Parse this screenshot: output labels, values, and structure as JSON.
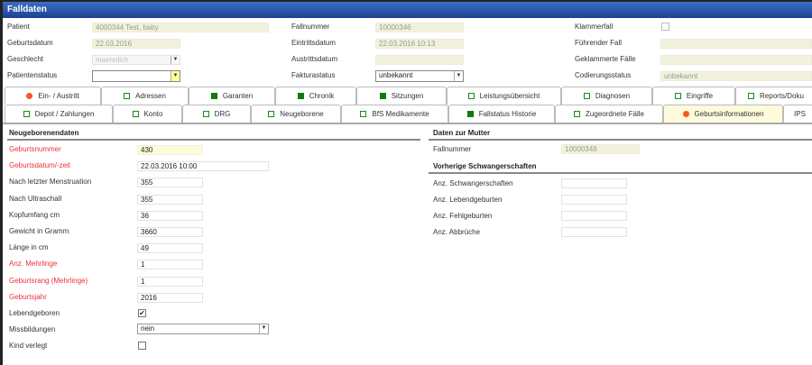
{
  "title": "Falldaten",
  "header": {
    "patient_label": "Patient",
    "patient_value": "4000344 Test,  baby",
    "geburtsdatum_label": "Geburtsdatum",
    "geburtsdatum_value": "22.03.2016",
    "geschlecht_label": "Geschlecht",
    "geschlecht_value": "maennlich",
    "patientenstatus_label": "Patientenstatus",
    "patientenstatus_value": "",
    "fallnummer_label": "Fallnummer",
    "fallnummer_value": "10000346",
    "eintrittsdatum_label": "Eintrittsdatum",
    "eintrittsdatum_value": "22.03.2016 10:13",
    "austrittsdatum_label": "Austrittsdatum",
    "austrittsdatum_value": "",
    "fakturastatus_label": "Fakturastatus",
    "fakturastatus_value": "unbekannt",
    "klammerfall_label": "Klammerfall",
    "fuehrender_fall_label": "Führender Fall",
    "geklammerte_faelle_label": "Geklammerte Fälle",
    "codierungsstatus_label": "Codierungsstatus",
    "codierungsstatus_value": "unbekannt"
  },
  "tabs_row1": [
    {
      "label": "Ein- / Austritt",
      "icon": "dot"
    },
    {
      "label": "Adressen",
      "icon": "open"
    },
    {
      "label": "Garanten",
      "icon": "fill"
    },
    {
      "label": "Chronik",
      "icon": "fill"
    },
    {
      "label": "Sitzungen",
      "icon": "fill"
    },
    {
      "label": "Leistungsübersicht",
      "icon": "open"
    },
    {
      "label": "Diagnosen",
      "icon": "open"
    },
    {
      "label": "Eingriffe",
      "icon": "open"
    },
    {
      "label": "Reports/Doku",
      "icon": "open"
    }
  ],
  "tabs_row2": [
    {
      "label": "Depot / Zahlungen",
      "icon": "open"
    },
    {
      "label": "Konto",
      "icon": "open"
    },
    {
      "label": "DRG",
      "icon": "open"
    },
    {
      "label": "Neugeborene",
      "icon": "open"
    },
    {
      "label": "BfS Medikamente",
      "icon": "open"
    },
    {
      "label": "Fallstatus Historie",
      "icon": "fill"
    },
    {
      "label": "Zugeordnete Fälle",
      "icon": "open"
    },
    {
      "label": "Geburtsinformationen",
      "icon": "dot"
    },
    {
      "label": "IPS",
      "icon": ""
    }
  ],
  "neugeborene": {
    "title": "Neugeborenendaten",
    "fields": [
      {
        "label": "Geburtsnummer",
        "value": "430"
      },
      {
        "label": "Geburtsdatum/-zeit",
        "value": "22.03.2016 10:00"
      },
      {
        "label": "Nach letzter Menstruation",
        "value": "355"
      },
      {
        "label": "Nach Ultraschall",
        "value": "355"
      },
      {
        "label": "Kopfumfang cm",
        "value": "36"
      },
      {
        "label": "Gewicht in Gramm",
        "value": "3660"
      },
      {
        "label": "Länge in cm",
        "value": "49"
      },
      {
        "label": "Anz. Mehrlinge",
        "value": "1"
      },
      {
        "label": "Geburtsrang (Mehrlinge)",
        "value": "1"
      },
      {
        "label": "Geburtsjahr",
        "value": "2016"
      }
    ],
    "lebendgeboren_label": "Lebendgeboren",
    "lebendgeboren_checked": true,
    "missbildungen_label": "Missbildungen",
    "missbildungen_value": "nein",
    "kind_verlegt_label": "Kind verlegt",
    "kind_verlegt_checked": false
  },
  "mutter": {
    "title": "Daten zur Mutter",
    "fallnummer_label": "Fallnummer",
    "fallnummer_value": "10000348",
    "vorherige_title": "Vorherige Schwangerschaften",
    "fields": [
      {
        "label": "Anz. Schwangerschaften",
        "value": ""
      },
      {
        "label": "Anz. Lebendgeburten",
        "value": ""
      },
      {
        "label": "Anz. Fehlgeburten",
        "value": ""
      },
      {
        "label": "Anz. Abbrüche",
        "value": ""
      }
    ]
  }
}
